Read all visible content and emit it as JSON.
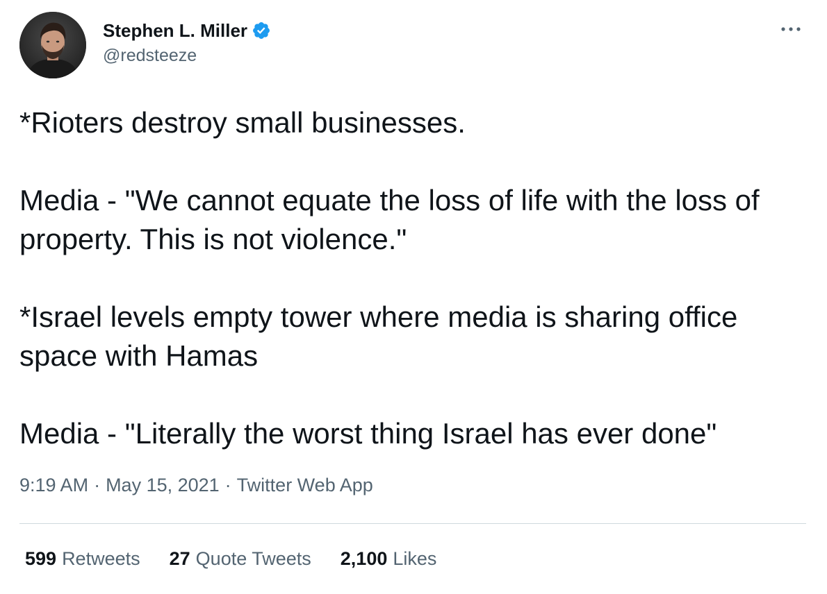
{
  "author": {
    "display_name": "Stephen L. Miller",
    "handle": "@redsteeze",
    "verified": true,
    "avatar_icon": "profile-photo-icon"
  },
  "more_icon": "more-horizontal-icon",
  "tweet": {
    "paragraphs": [
      "*Rioters destroy small businesses.",
      "Media - \"We cannot equate the loss of life with the loss of property.  This is not violence.\"",
      "*Israel levels empty tower where media is sharing office space with Hamas",
      "Media - \"Literally the worst thing Israel has ever done\""
    ]
  },
  "meta": {
    "time": "9:19 AM",
    "date": "May 15, 2021",
    "source": "Twitter Web App",
    "separator": "·"
  },
  "stats": {
    "retweets_count": "599",
    "retweets_label": "Retweets",
    "quotes_count": "27",
    "quotes_label": "Quote Tweets",
    "likes_count": "2,100",
    "likes_label": "Likes"
  },
  "colors": {
    "text_primary": "#0f1419",
    "text_secondary": "#536471",
    "verified_blue": "#1d9bf0",
    "divider": "#cfd9de"
  }
}
